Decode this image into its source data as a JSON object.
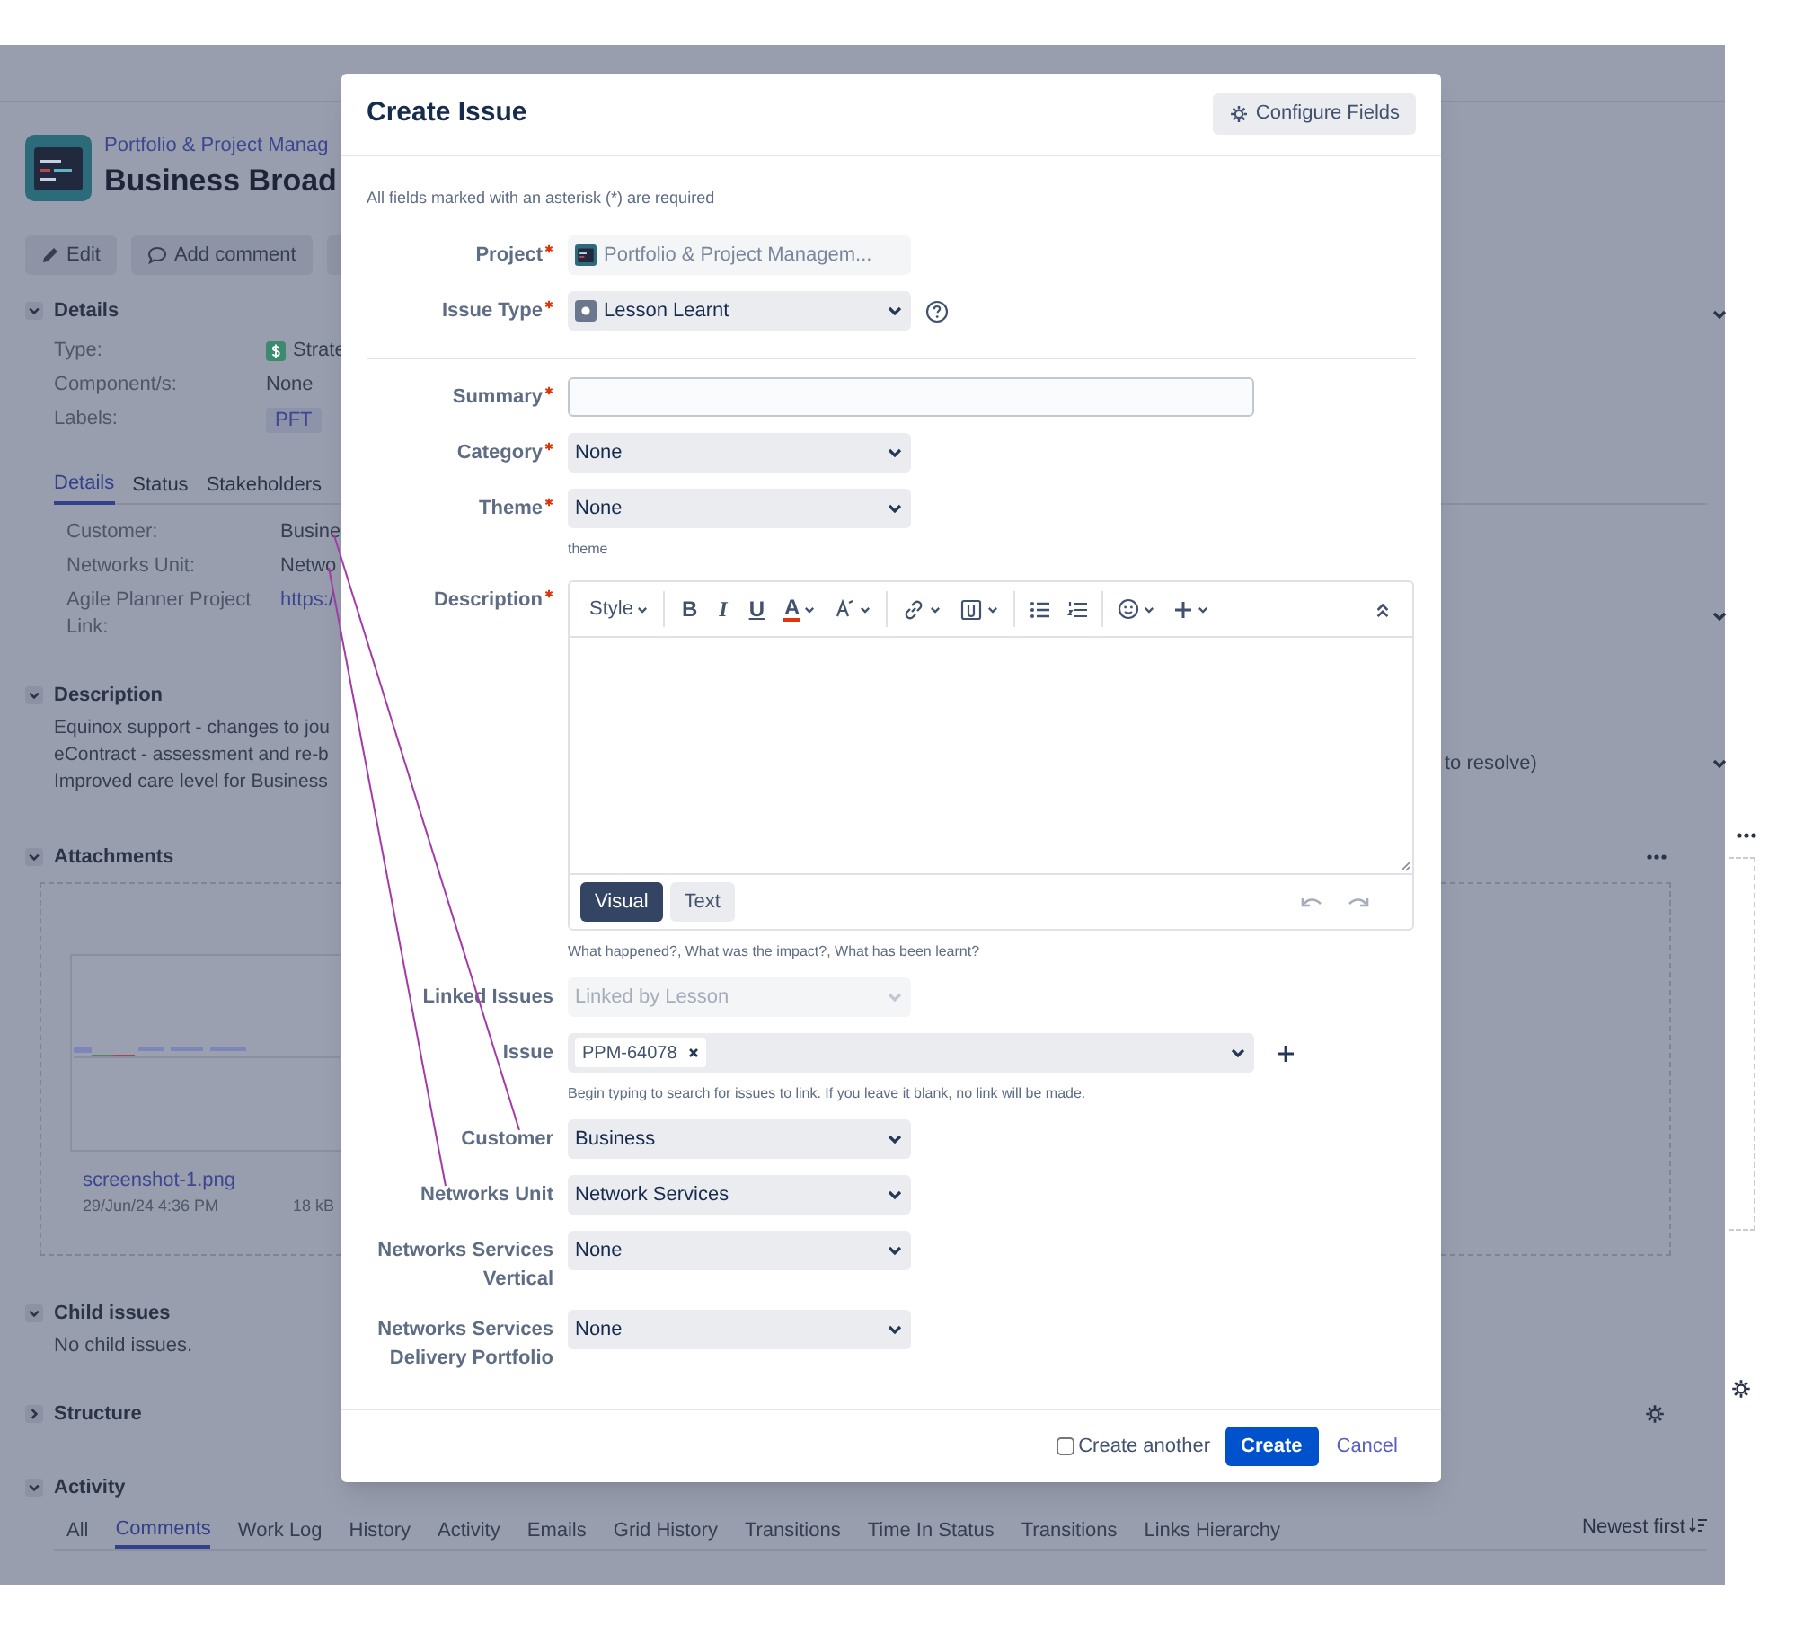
{
  "issue_page": {
    "project": "Portfolio & Project Manag",
    "title": "Business Broad",
    "actions": [
      {
        "kind": "edit",
        "label": "Edit"
      },
      {
        "kind": "comment",
        "label": "Add comment"
      },
      {
        "kind": "blank"
      }
    ],
    "details": {
      "heading": "Details",
      "expanded": true,
      "rows": [
        {
          "kind": "type",
          "label": "Type:",
          "value": "Strate"
        },
        {
          "kind": "text",
          "label": "Component/s:",
          "value": "None"
        },
        {
          "kind": "tag",
          "label": "Labels:",
          "value": "PFT"
        }
      ],
      "tabs": [
        {
          "label": "Details",
          "selected": true
        },
        {
          "label": "Status",
          "selected": false
        },
        {
          "label": "Stakeholders",
          "selected": false
        }
      ],
      "fields": [
        {
          "kind": "text",
          "label": "Customer:",
          "value": "Busine"
        },
        {
          "kind": "text",
          "label": "Networks Unit:",
          "value": "Netwo"
        },
        {
          "kind": "link",
          "label": "Agile Planner Project Link:",
          "value": "https:/"
        }
      ]
    },
    "description": {
      "heading": "Description",
      "expanded": true,
      "lines": [
        "Equinox support - changes to jou",
        "eContract - assessment and re-b",
        "Improved care level for Business"
      ],
      "line_2_end": "to resolve)"
    },
    "attachments": {
      "heading": "Attachments",
      "expanded": true,
      "file": "screenshot-1.png",
      "date": "29/Jun/24 4:36 PM",
      "size": "18 kB"
    },
    "child_issues": {
      "heading": "Child issues",
      "expanded": true,
      "text": "No child issues."
    },
    "structure": {
      "heading": "Structure",
      "expanded": false
    },
    "activity": {
      "heading": "Activity",
      "expanded": true,
      "tabs": [
        {
          "label": "All",
          "selected": false
        },
        {
          "label": "Comments",
          "selected": true
        },
        {
          "label": "Work Log",
          "selected": false
        },
        {
          "label": "History",
          "selected": false
        },
        {
          "label": "Activity",
          "selected": false
        },
        {
          "label": "Emails",
          "selected": false
        },
        {
          "label": "Grid History",
          "selected": false
        },
        {
          "label": "Transitions",
          "selected": false
        },
        {
          "label": "Time In Status",
          "selected": false
        },
        {
          "label": "Transitions",
          "selected": false
        },
        {
          "label": "Links Hierarchy",
          "selected": false
        }
      ],
      "sort": "Newest first"
    }
  },
  "dialog": {
    "title": "Create Issue",
    "configure_button": "Configure Fields",
    "note": "All fields marked with an asterisk (*) are required",
    "field_groups": [
      [
        {
          "kind": "readonly",
          "label": "Project",
          "required": true,
          "value": "Portfolio & Project Managem..."
        },
        {
          "kind": "type_select",
          "label": "Issue Type",
          "required": true,
          "value": "Lesson Learnt"
        }
      ],
      [
        {
          "kind": "text",
          "label": "Summary",
          "required": true
        },
        {
          "kind": "select",
          "label": "Category",
          "required": true,
          "value": "None"
        },
        {
          "kind": "select",
          "label": "Theme",
          "required": true,
          "value": "None",
          "hint": "theme"
        },
        {
          "kind": "editor",
          "label": "Description",
          "required": true,
          "hint": "What happened?, What was the impact?, What has been learnt?",
          "toolbar": [
            {
              "kind": "style",
              "text": "Style"
            },
            {
              "kind": "bold",
              "text": "B"
            },
            {
              "kind": "italic",
              "text": "I"
            },
            {
              "kind": "underline",
              "text": "U"
            },
            {
              "kind": "color",
              "text": "A"
            },
            {
              "kind": "format"
            },
            {
              "kind": "link"
            },
            {
              "kind": "attach"
            },
            {
              "kind": "bullets"
            },
            {
              "kind": "numbers"
            },
            {
              "kind": "emoji"
            },
            {
              "kind": "insert"
            },
            {
              "kind": "collapse"
            }
          ],
          "modes": [
            {
              "label": "Visual",
              "selected": true
            },
            {
              "label": "Text",
              "selected": false
            }
          ]
        },
        {
          "kind": "disabled_select",
          "label": "Linked Issues",
          "required": false,
          "value": "Linked by Lesson"
        },
        {
          "kind": "tags",
          "label": "Issue",
          "required": false,
          "tags": [
            "PPM-64078"
          ],
          "hint": "Begin typing to search for issues to link. If you leave it blank, no link will be made."
        },
        {
          "kind": "select",
          "label": "Customer",
          "required": false,
          "value": "Business"
        },
        {
          "kind": "select",
          "label": "Networks Unit",
          "required": false,
          "value": "Network Services"
        },
        {
          "kind": "select",
          "label": "Networks Services Vertical",
          "required": false,
          "value": "None"
        },
        {
          "kind": "select",
          "label": "Networks Services Delivery Portfolio",
          "required": false,
          "value": "None"
        }
      ]
    ],
    "create_another": {
      "label": "Create another",
      "checked": false
    },
    "create_button": "Create",
    "cancel_link": "Cancel"
  }
}
